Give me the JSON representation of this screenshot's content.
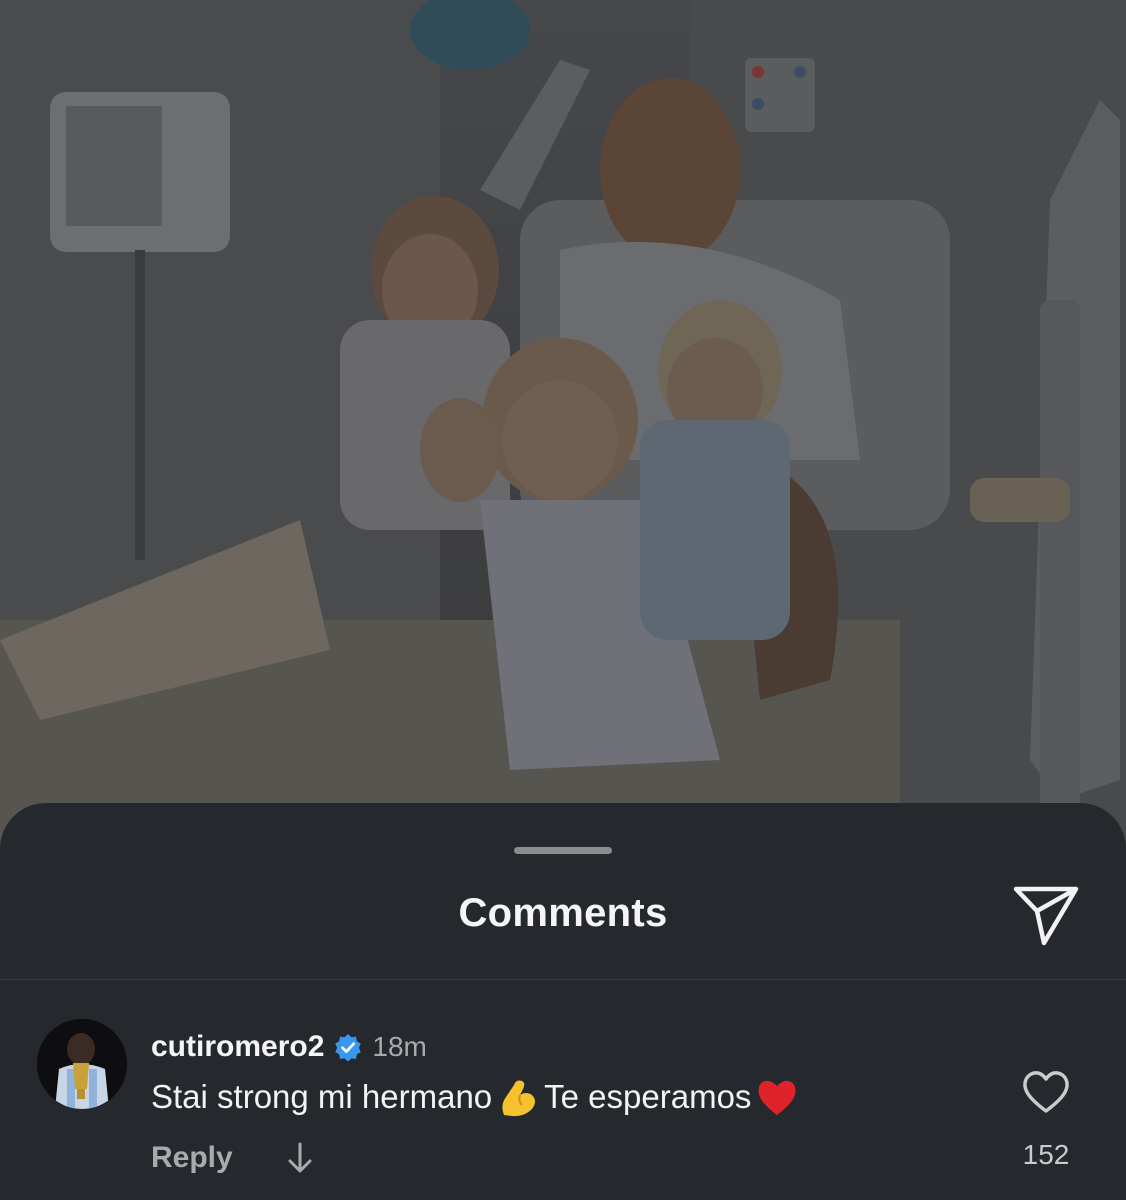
{
  "post": {
    "photo_icon": "photo-background"
  },
  "sheet": {
    "title": "Comments",
    "share_icon": "paper-plane-icon"
  },
  "comment": {
    "username": "cutiromero2",
    "verified_icon": "verified-badge-icon",
    "time": "18m",
    "text_part1": "Stai strong mi hermano",
    "emoji1": "flexed-biceps-emoji",
    "text_part2": "Te esperamos",
    "emoji2": "red-heart-emoji",
    "reply_label": "Reply",
    "translate_icon": "arrow-down-icon",
    "like_icon": "heart-outline-icon",
    "like_count": "152"
  },
  "colors": {
    "sheet_bg": "#25282d",
    "verified_blue": "#3897f0",
    "heart_red": "#e0222b",
    "muscle_yellow": "#f5c22d"
  }
}
